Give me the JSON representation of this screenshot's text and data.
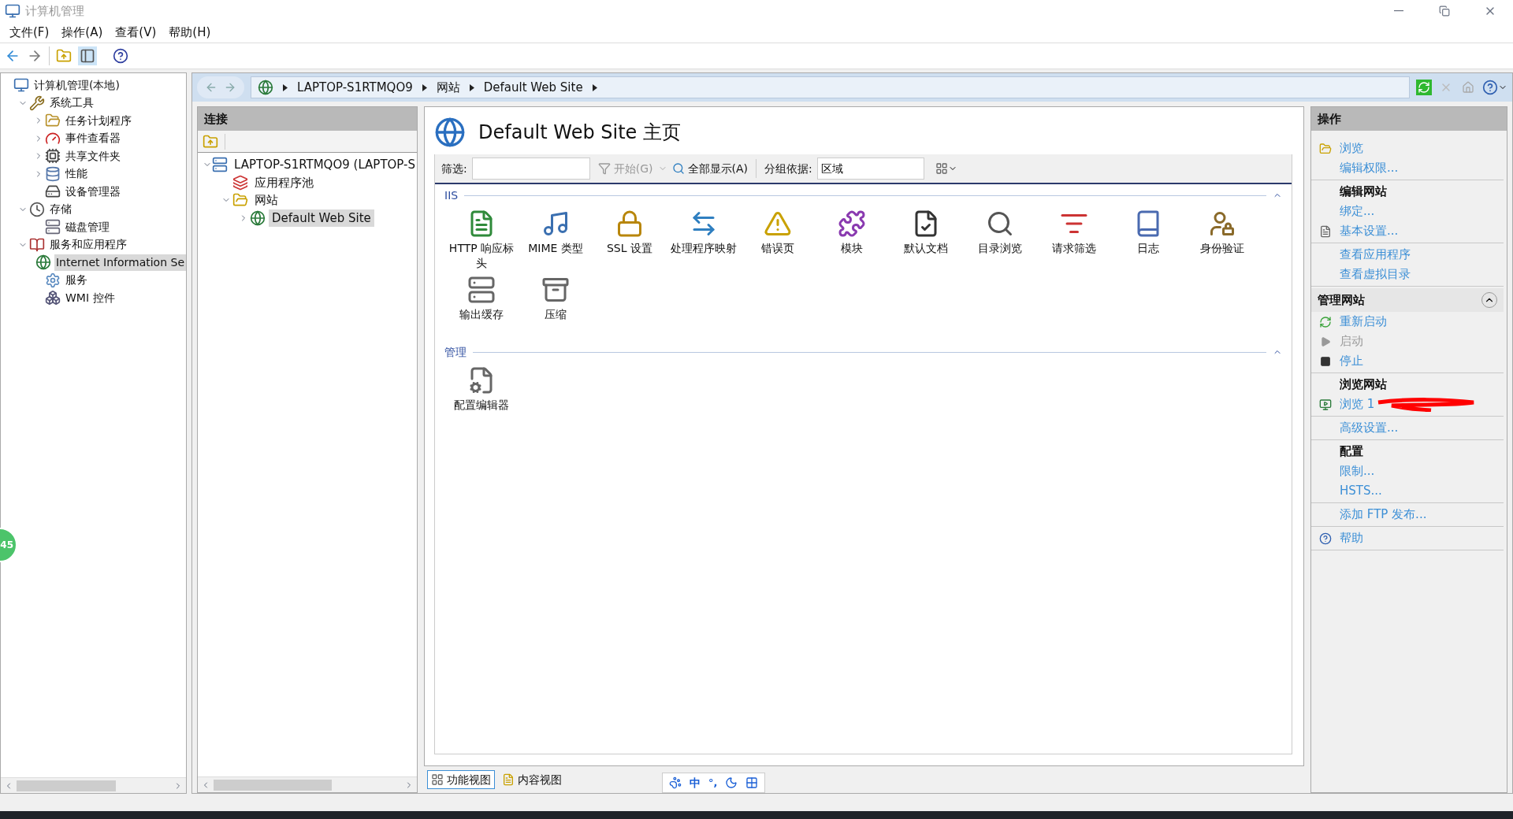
{
  "window": {
    "title": "计算机管理"
  },
  "menu": [
    "文件(F)",
    "操作(A)",
    "查看(V)",
    "帮助(H)"
  ],
  "left_tree": [
    {
      "label": "计算机管理(本地)",
      "selected": false,
      "children": [
        {
          "label": "系统工具",
          "expanded": true,
          "selected": false,
          "children": [
            {
              "label": "任务计划程序",
              "expanded": false,
              "selected": false
            },
            {
              "label": "事件查看器",
              "expanded": false,
              "selected": false
            },
            {
              "label": "共享文件夹",
              "expanded": false,
              "selected": false
            },
            {
              "label": "性能",
              "expanded": false,
              "selected": false
            },
            {
              "label": "设备管理器",
              "selected": false
            }
          ]
        },
        {
          "label": "存储",
          "expanded": true,
          "selected": false,
          "children": [
            {
              "label": "磁盘管理",
              "selected": false
            }
          ]
        },
        {
          "label": "服务和应用程序",
          "expanded": true,
          "selected": false,
          "children": [
            {
              "label": "Internet Information Se",
              "selected": true
            },
            {
              "label": "服务",
              "selected": false
            },
            {
              "label": "WMI 控件",
              "selected": false
            }
          ]
        }
      ]
    }
  ],
  "address_bar": {
    "crumbs": [
      "LAPTOP-S1RTMQO9",
      "网站",
      "Default Web Site"
    ]
  },
  "connections": {
    "title": "连接",
    "tree": [
      {
        "label": "LAPTOP-S1RTMQO9 (LAPTOP-S",
        "expanded": true,
        "selected": false,
        "children": [
          {
            "label": "应用程序池",
            "selected": false
          },
          {
            "label": "网站",
            "expanded": true,
            "selected": false,
            "children": [
              {
                "label": "Default Web Site",
                "expanded": false,
                "selected": true
              }
            ]
          }
        ]
      }
    ]
  },
  "center": {
    "title": "Default Web Site 主页",
    "filter": {
      "label": "筛选:",
      "start": "开始(G)",
      "start_disabled": true,
      "show_all": "全部显示(A)",
      "group_label": "分组依据:",
      "group_value": "区域"
    },
    "groups": [
      {
        "title": "IIS",
        "items": [
          "HTTP 响应标头",
          "MIME 类型",
          "SSL 设置",
          "处理程序映射",
          "错误页",
          "模块",
          "默认文档",
          "目录浏览",
          "请求筛选",
          "日志",
          "身份验证",
          "输出缓存",
          "压缩"
        ]
      },
      {
        "title": "管理",
        "items": [
          "配置编辑器"
        ]
      }
    ],
    "view_tabs": [
      {
        "label": "功能视图",
        "selected": true
      },
      {
        "label": "内容视图",
        "selected": false
      }
    ]
  },
  "ime_bar": {
    "mode": "中",
    "punctuation": "°,"
  },
  "side_badge": "45",
  "actions": {
    "title": "操作",
    "sections": [
      {
        "items": [
          {
            "kind": "link",
            "label": "浏览",
            "icon": true,
            "disabled": false
          },
          {
            "kind": "link",
            "label": "编辑权限...",
            "disabled": false
          }
        ]
      },
      {
        "heading": "编辑网站",
        "items": [
          {
            "kind": "link",
            "label": "绑定...",
            "disabled": false
          },
          {
            "kind": "link",
            "label": "基本设置...",
            "icon": true,
            "disabled": false
          }
        ]
      },
      {
        "items": [
          {
            "kind": "link",
            "label": "查看应用程序",
            "disabled": false
          },
          {
            "kind": "link",
            "label": "查看虚拟目录",
            "disabled": false
          }
        ]
      },
      {
        "header": "管理网站",
        "items": [
          {
            "kind": "restart",
            "label": "重新启动",
            "disabled": false
          },
          {
            "kind": "start",
            "label": "启动",
            "disabled": true
          },
          {
            "kind": "stop",
            "label": "停止",
            "disabled": false
          }
        ]
      },
      {
        "heading": "浏览网站",
        "items": [
          {
            "kind": "browse",
            "label": "浏览 1",
            "redacted": true,
            "disabled": false
          }
        ]
      },
      {
        "items": [
          {
            "kind": "link",
            "label": "高级设置...",
            "disabled": false
          }
        ]
      },
      {
        "heading": "配置",
        "items": [
          {
            "kind": "link",
            "label": "限制...",
            "disabled": false
          },
          {
            "kind": "link",
            "label": "HSTS...",
            "disabled": false
          }
        ]
      },
      {
        "items": [
          {
            "kind": "link",
            "label": "添加 FTP 发布...",
            "disabled": false
          }
        ]
      },
      {
        "items": [
          {
            "kind": "help",
            "label": "帮助",
            "disabled": false
          }
        ]
      }
    ]
  }
}
